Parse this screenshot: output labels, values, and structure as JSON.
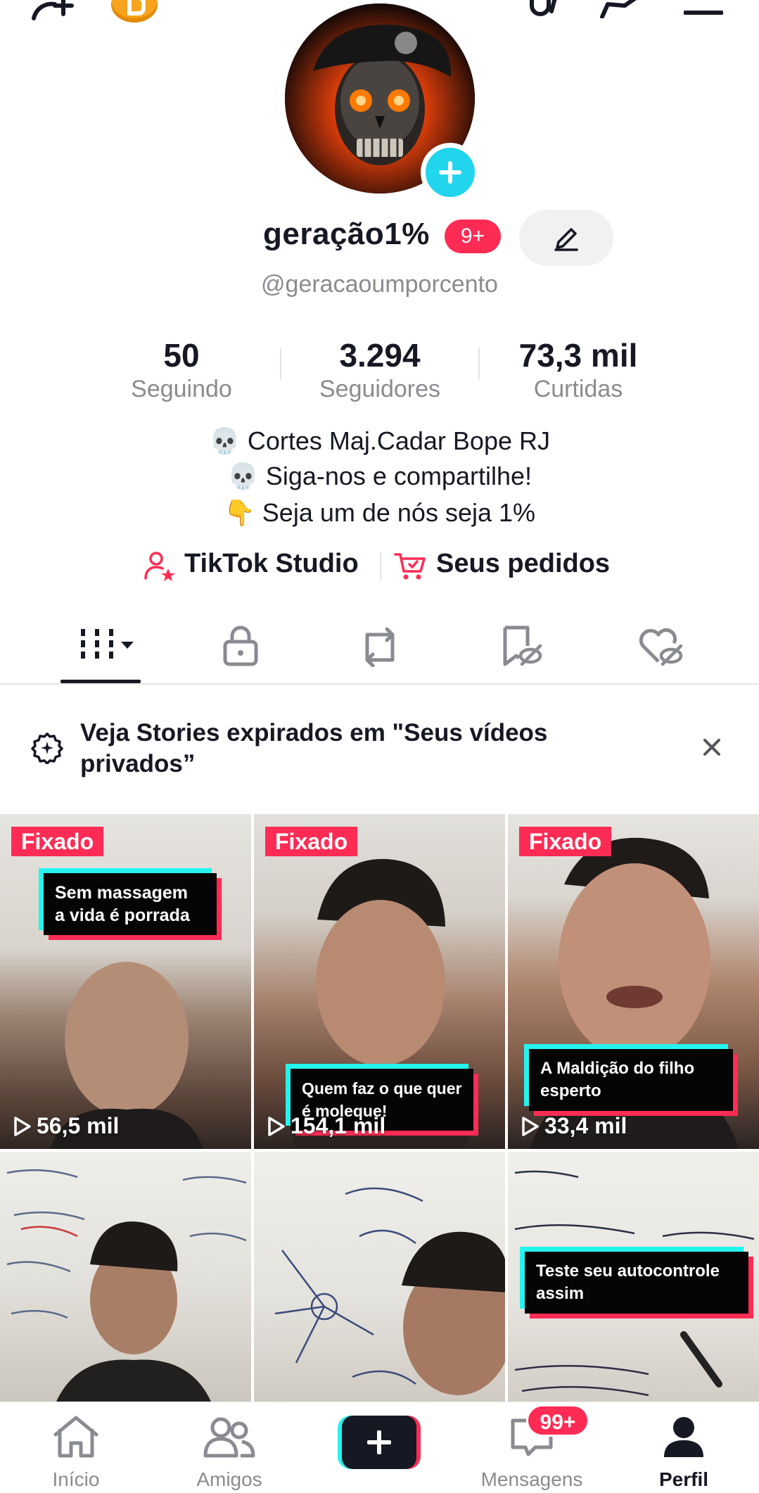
{
  "profile": {
    "display_name": "geração1%",
    "notification_badge": "9+",
    "handle": "@geracaoumporcento"
  },
  "stats": [
    {
      "value": "50",
      "label": "Seguindo"
    },
    {
      "value": "3.294",
      "label": "Seguidores"
    },
    {
      "value": "73,3 mil",
      "label": "Curtidas"
    }
  ],
  "bio": [
    "💀 Cortes Maj.Cadar Bope RJ",
    "💀 Siga-nos e compartilhe!",
    "👇 Seja um de nós seja 1%"
  ],
  "links": {
    "studio": "TikTok Studio",
    "orders": "Seus pedidos"
  },
  "banner": {
    "text": "Veja Stories expirados em \"Seus vídeos privados”"
  },
  "videos": [
    {
      "pinned": "Fixado",
      "views": "56,5 mil",
      "caption": [
        "Sem massagem",
        "a vida é porrada"
      ]
    },
    {
      "pinned": "Fixado",
      "views": "154,1 mil",
      "caption": [
        "Quem faz o que quer",
        "é moleque!"
      ]
    },
    {
      "pinned": "Fixado",
      "views": "33,4 mil",
      "caption": [
        "A Maldição do filho",
        "esperto"
      ]
    },
    {
      "pinned": "",
      "views": "",
      "caption": []
    },
    {
      "pinned": "",
      "views": "",
      "caption": []
    },
    {
      "pinned": "",
      "views": "",
      "caption": [
        "Teste seu autocontrole",
        "assim"
      ]
    }
  ],
  "nav": {
    "home": "Início",
    "friends": "Amigos",
    "messages": "Mensagens",
    "messages_badge": "99+",
    "profile": "Perfil"
  },
  "colors": {
    "accent_red": "#fe2c55",
    "accent_cyan": "#25f4ee",
    "add_badge": "#20d5ec",
    "coin": "#f7a31b"
  }
}
